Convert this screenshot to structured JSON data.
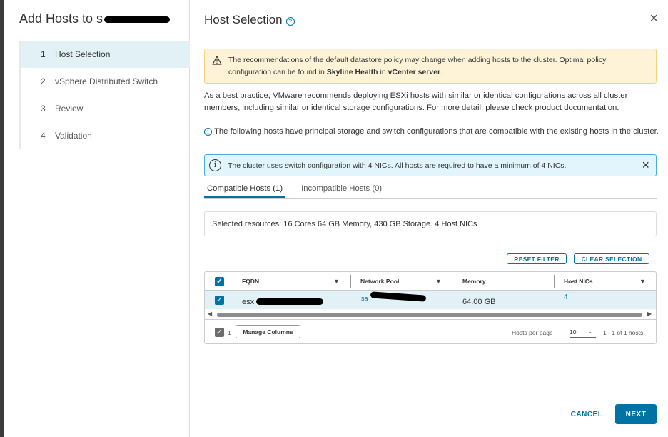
{
  "wizard": {
    "title": "Add Hosts to s",
    "steps": [
      {
        "num": "1",
        "label": "Host Selection",
        "active": true
      },
      {
        "num": "2",
        "label": "vSphere Distributed Switch",
        "active": false
      },
      {
        "num": "3",
        "label": "Review",
        "active": false
      },
      {
        "num": "4",
        "label": "Validation",
        "active": false
      }
    ]
  },
  "page": {
    "title": "Host Selection",
    "help_icon": "?",
    "close_icon": "×"
  },
  "warning": {
    "icon": "warning-triangle-icon",
    "text_before": "The recommendations of the default datastore policy may change when adding hosts to the cluster. Optimal policy configuration can be found in ",
    "bold1": "Skyline Health",
    "text_mid": " in ",
    "bold2": "vCenter server",
    "text_after": "."
  },
  "best_practice": "As a best practice, VMware recommends deploying ESXi hosts with similar or identical configurations across all cluster members, including similar or identical storage configurations. For more detail, please check product documentation.",
  "compat_note": "The following hosts have principal storage and switch configurations that are compatible with the existing hosts in the cluster.",
  "info_box": {
    "text": "The cluster uses switch configuration with 4 NICs. All hosts are required to have a minimum of 4 NICs.",
    "dismiss": "×"
  },
  "tabs": [
    {
      "label": "Compatible Hosts (1)",
      "active": true
    },
    {
      "label": "Incompatible Hosts (0)",
      "active": false
    }
  ],
  "selected_resources": "Selected resources: 16 Cores 64 GB Memory, 430 GB Storage. 4 Host NICs",
  "buttons": {
    "reset_filter": "RESET FILTER",
    "clear_selection": "CLEAR SELECTION",
    "cancel": "CANCEL",
    "next": "NEXT"
  },
  "grid": {
    "columns": [
      "FQDN",
      "Network Pool",
      "Memory",
      "Host NICs"
    ],
    "rows": [
      {
        "fqdn": "esx",
        "network_pool": "sa",
        "memory": "64.00 GB",
        "host_nics": "4",
        "selected": true
      }
    ],
    "footer": {
      "selected_count": "1",
      "manage_columns": "Manage Columns",
      "hosts_per_page_label": "Hosts per page",
      "per_page": "10",
      "range": "1 - 1 of 1 hosts"
    }
  },
  "colors": {
    "accent": "#0072a3",
    "active_step_bg": "#e1f1f6",
    "warning_bg": "#fef3d6",
    "info_bg": "#e3f5fc"
  }
}
